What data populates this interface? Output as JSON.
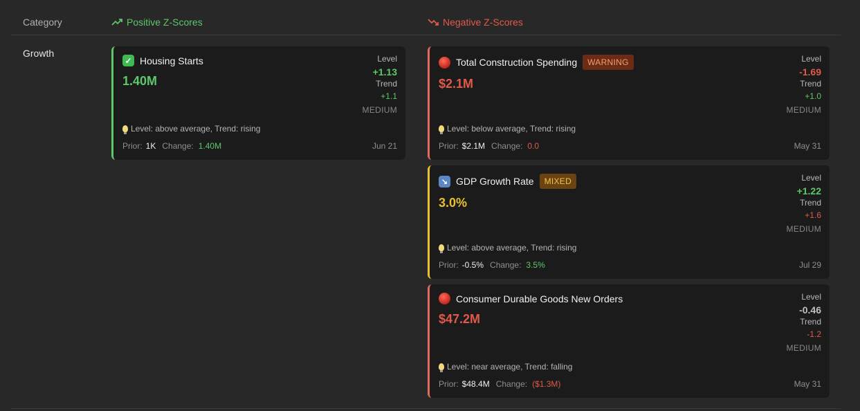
{
  "header": {
    "category": "Category",
    "positive": "Positive Z-Scores",
    "negative": "Negative Z-Scores"
  },
  "category": "Growth",
  "colors": {
    "positive": "#5cc86a",
    "negative": "#e05a4a",
    "mixed": "#e8c034"
  },
  "positive_cards": [
    {
      "icon": "check-mark-icon",
      "title": "Housing Starts",
      "value": "1.40M",
      "level_label": "Level",
      "level": "+1.13",
      "trend_label": "Trend",
      "trend": "+1.1",
      "confidence": "MEDIUM",
      "insight": "Level: above average, Trend: rising",
      "prior_label": "Prior:",
      "prior": "1K",
      "change_label": "Change:",
      "change": "1.40M",
      "date": "Jun 21"
    }
  ],
  "negative_cards": [
    {
      "icon": "red-circle-icon",
      "title": "Total Construction Spending",
      "badge": "WARNING",
      "value": "$2.1M",
      "level_label": "Level",
      "level": "-1.69",
      "trend_label": "Trend",
      "trend": "+1.0",
      "confidence": "MEDIUM",
      "insight": "Level: below average, Trend: rising",
      "prior_label": "Prior:",
      "prior": "$2.1M",
      "change_label": "Change:",
      "change": "0.0",
      "date": "May 31"
    },
    {
      "icon": "arrow-down-right-icon",
      "title": "GDP Growth Rate",
      "badge": "MIXED",
      "value": "3.0%",
      "level_label": "Level",
      "level": "+1.22",
      "trend_label": "Trend",
      "trend": "+1.6",
      "confidence": "MEDIUM",
      "insight": "Level: above average, Trend: rising",
      "prior_label": "Prior:",
      "prior": "-0.5%",
      "change_label": "Change:",
      "change": "3.5%",
      "date": "Jul 29"
    },
    {
      "icon": "red-circle-icon",
      "title": "Consumer Durable Goods New Orders",
      "value": "$47.2M",
      "level_label": "Level",
      "level": "-0.46",
      "trend_label": "Trend",
      "trend": "-1.2",
      "confidence": "MEDIUM",
      "insight": "Level: near average, Trend: falling",
      "prior_label": "Prior:",
      "prior": "$48.4M",
      "change_label": "Change:",
      "change": "($1.3M)",
      "date": "May 31"
    }
  ]
}
